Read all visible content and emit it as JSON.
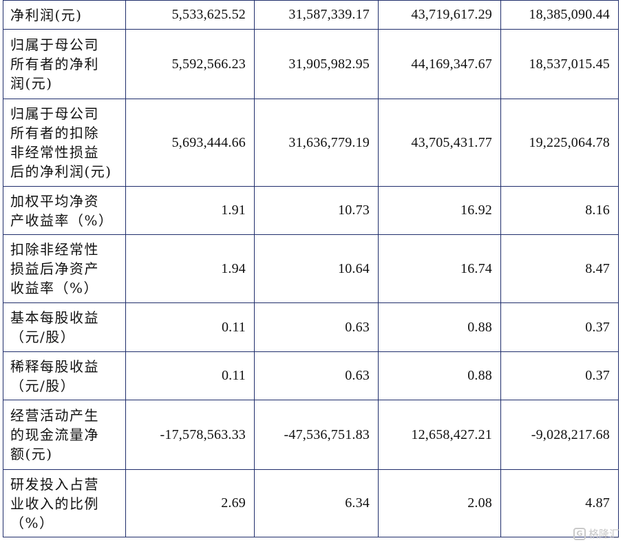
{
  "rows": [
    {
      "label": "净利润(元)",
      "values": [
        "5,533,625.52",
        "31,587,339.17",
        "43,719,617.29",
        "18,385,090.44"
      ]
    },
    {
      "label": "归属于母公司\n所有者的净利\n润(元)",
      "values": [
        "5,592,566.23",
        "31,905,982.95",
        "44,169,347.67",
        "18,537,015.45"
      ]
    },
    {
      "label": "归属于母公司\n所有者的扣除\n非经常性损益\n后的净利润(元)",
      "values": [
        "5,693,444.66",
        "31,636,779.19",
        "43,705,431.77",
        "19,225,064.78"
      ]
    },
    {
      "label": "加权平均净资\n产收益率（%）",
      "values": [
        "1.91",
        "10.73",
        "16.92",
        "8.16"
      ]
    },
    {
      "label": "扣除非经常性\n损益后净资产\n收益率（%）",
      "values": [
        "1.94",
        "10.64",
        "16.74",
        "8.47"
      ]
    },
    {
      "label": "基本每股收益\n（元/股）",
      "values": [
        "0.11",
        "0.63",
        "0.88",
        "0.37"
      ]
    },
    {
      "label": "稀释每股收益\n（元/股）",
      "values": [
        "0.11",
        "0.63",
        "0.88",
        "0.37"
      ]
    },
    {
      "label": "经营活动产生\n的现金流量净\n额(元)",
      "values": [
        "-17,578,563.33",
        "-47,536,751.83",
        "12,658,427.21",
        "-9,028,217.68"
      ]
    },
    {
      "label": "研发投入占营\n业收入的比例\n（%）",
      "values": [
        "2.69",
        "6.34",
        "2.08",
        "4.87"
      ]
    }
  ],
  "watermark": {
    "icon": "G",
    "text": "格隆汇"
  }
}
